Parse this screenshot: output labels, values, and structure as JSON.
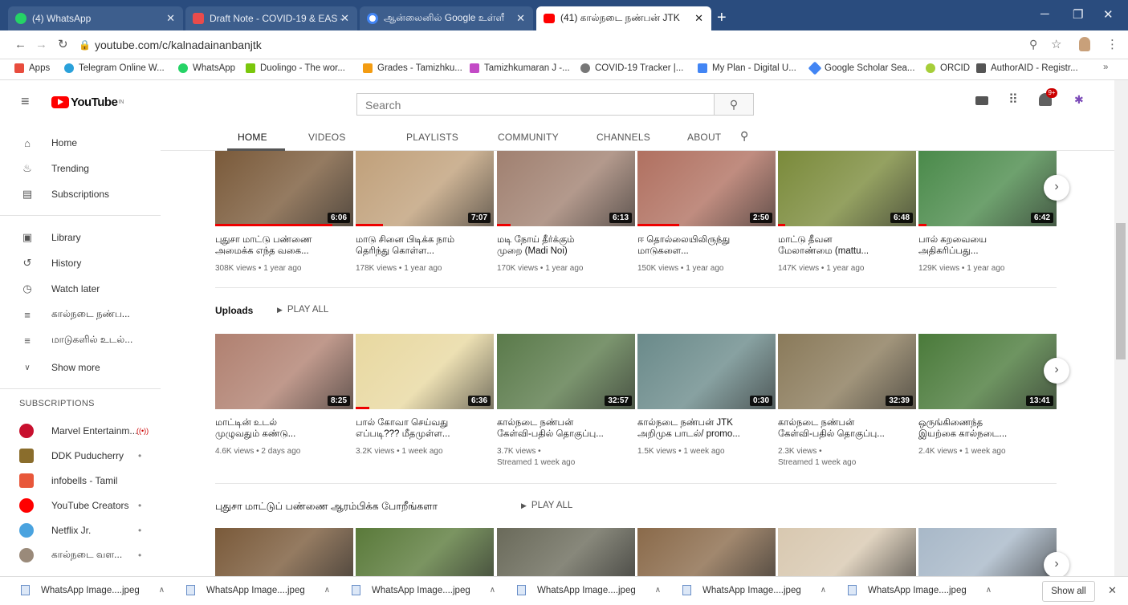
{
  "browser": {
    "tabs": [
      {
        "label": "(4) WhatsApp",
        "color": "#25d366"
      },
      {
        "label": "Draft Note - COVID-19 & EAS -",
        "color": "#e94b4b"
      },
      {
        "label": "ஆன்லைனில் Google உள்ளீ",
        "color": "#ffffff"
      },
      {
        "label": "(41) கால்நடை நண்பன் JTK",
        "color": "#ff0000"
      }
    ],
    "url": "youtube.com/c/kalnadainanbanjtk",
    "bookmarks": [
      {
        "label": "Apps",
        "color": "#e84c3d"
      },
      {
        "label": "Telegram Online W...",
        "color": "#2aa1da"
      },
      {
        "label": "WhatsApp",
        "color": "#25d366"
      },
      {
        "label": "Duolingo - The wor...",
        "color": "#7ac70c"
      },
      {
        "label": "Grades - Tamizhku...",
        "color": "#f39c12"
      },
      {
        "label": "Tamizhkumaran J -...",
        "color": "#c34ac6"
      },
      {
        "label": "COVID-19 Tracker |...",
        "color": "#777777"
      },
      {
        "label": "My Plan - Digital U...",
        "color": "#4285f4"
      },
      {
        "label": "Google Scholar Sea...",
        "color": "#4285f4"
      },
      {
        "label": "ORCID",
        "color": "#a6ce39"
      },
      {
        "label": "AuthorAID - Registr...",
        "color": "#555555"
      }
    ]
  },
  "youtube": {
    "logo": "YouTube",
    "logo_sup": "IN",
    "search_placeholder": "Search",
    "notif_count": "9+"
  },
  "sidebar": {
    "main": [
      {
        "label": "Home",
        "icon": "home-icon"
      },
      {
        "label": "Trending",
        "icon": "flame-icon"
      },
      {
        "label": "Subscriptions",
        "icon": "subscriptions-icon"
      }
    ],
    "library": [
      {
        "label": "Library",
        "icon": "library-icon"
      },
      {
        "label": "History",
        "icon": "history-icon"
      },
      {
        "label": "Watch later",
        "icon": "clock-icon"
      },
      {
        "label": "கால்நடை நண்ப...",
        "icon": "playlist-icon"
      },
      {
        "label": "மாடுகளில் உடல்...",
        "icon": "playlist-icon"
      },
      {
        "label": "Show more",
        "icon": "chevron-down-icon"
      }
    ],
    "subscriptions_header": "SUBSCRIPTIONS",
    "subscriptions": [
      {
        "label": "Marvel Entertainm...",
        "badge": "((•))",
        "color": "#c8102e"
      },
      {
        "label": "DDK Puducherry",
        "badge": "•",
        "color": "#8a6d2c"
      },
      {
        "label": "infobells - Tamil",
        "badge": "",
        "color": "#e8573a"
      },
      {
        "label": "YouTube Creators",
        "badge": "•",
        "color": "#ff0000"
      },
      {
        "label": "Netflix Jr.",
        "badge": "•",
        "color": "#4aa3df"
      },
      {
        "label": "கால்நடை வள...",
        "badge": "•",
        "color": "#9a8a7a"
      }
    ]
  },
  "channel_tabs": [
    "HOME",
    "VIDEOS",
    "PLAYLISTS",
    "COMMUNITY",
    "CHANNELS",
    "ABOUT"
  ],
  "shelves": {
    "top": {
      "videos": [
        {
          "title1": "புதுசா மாட்டு பண்ணை",
          "title2": "அமைக்க எந்த வகை...",
          "meta1": "308K views • 1 year ago",
          "meta2": "",
          "duration": "6:06",
          "color": "#7a5a3a",
          "progress": 0.85
        },
        {
          "title1": "மாடு சினை பிடிக்க நாம்",
          "title2": "தெரிந்து கொள்ள...",
          "meta1": "178K views • 1 year ago",
          "meta2": "",
          "duration": "7:07",
          "color": "#c0a07a",
          "progress": 0.2
        },
        {
          "title1": "மடி நோய் தீர்க்கும்",
          "title2": "முறை (Madi Noi)",
          "meta1": "170K views • 1 year ago",
          "meta2": "",
          "duration": "6:13",
          "color": "#a08070",
          "progress": 0.1
        },
        {
          "title1": "ஈ தொல்லையிலிருந்து",
          "title2": "மாடுகளை...",
          "meta1": "150K views • 1 year ago",
          "meta2": "",
          "duration": "2:50",
          "color": "#b07060",
          "progress": 0.3
        },
        {
          "title1": "மாட்டு தீவன",
          "title2": "மேலாண்மை (mattu...",
          "meta1": "147K views • 1 year ago",
          "meta2": "",
          "duration": "6:48",
          "color": "#7a8a3a",
          "progress": 0.05
        },
        {
          "title1": "பால் கறவையை",
          "title2": "அதிகரிப்பது...",
          "meta1": "129K views • 1 year ago",
          "meta2": "",
          "duration": "6:42",
          "color": "#4a8a4a",
          "progress": 0.06
        }
      ]
    },
    "uploads": {
      "title": "Uploads",
      "play_all": "PLAY ALL",
      "videos": [
        {
          "title1": "மாட்டின் உடல்",
          "title2": "முழுவதும் கண்டு...",
          "meta1": "4.6K views • 2 days ago",
          "meta2": "",
          "duration": "8:25",
          "color": "#b08070",
          "progress": 0
        },
        {
          "title1": "பால் கோவா செய்வது",
          "title2": "எப்படி??? மீதமுள்ள...",
          "meta1": "3.2K views • 1 week ago",
          "meta2": "",
          "duration": "6:36",
          "color": "#e8d8a0",
          "progress": 0.1
        },
        {
          "title1": "கால்நடை நண்பன்",
          "title2": "கேள்வி-பதில் தொகுப்பு...",
          "meta1": "3.7K views •",
          "meta2": "Streamed 1 week ago",
          "duration": "32:57",
          "color": "#5a7a4a",
          "progress": 0
        },
        {
          "title1": "கால்நடை நண்பன் JTK",
          "title2": "அறிமுக பாடல்/ promo...",
          "meta1": "1.5K views • 1 week ago",
          "meta2": "",
          "duration": "0:30",
          "color": "#6a8a8a",
          "progress": 0
        },
        {
          "title1": "கால்நடை நண்பன்",
          "title2": "கேள்வி-பதில் தொகுப்பு...",
          "meta1": "2.3K views •",
          "meta2": "Streamed 1 week ago",
          "duration": "32:39",
          "color": "#8a7a5a",
          "progress": 0
        },
        {
          "title1": "ஒருங்கிணைந்த",
          "title2": "இயற்கை கால்நடை...",
          "meta1": "2.4K views • 1 week ago",
          "meta2": "",
          "duration": "13:41",
          "color": "#4a7a3a",
          "progress": 0
        }
      ]
    },
    "third": {
      "title": "புதுசா மாட்டுப் பண்ணை ஆரம்பிக்க போறீங்களா",
      "play_all": "PLAY ALL",
      "videos": [
        {
          "color": "#7a5a3a"
        },
        {
          "color": "#5a7a3a"
        },
        {
          "color": "#6a6a5a"
        },
        {
          "color": "#8a6a4a"
        },
        {
          "color": "#d8c8b0"
        },
        {
          "color": "#a8b8c8"
        }
      ]
    }
  },
  "downloads": {
    "items": [
      "WhatsApp Image....jpeg",
      "WhatsApp Image....jpeg",
      "WhatsApp Image....jpeg",
      "WhatsApp Image....jpeg",
      "WhatsApp Image....jpeg",
      "WhatsApp Image....jpeg"
    ],
    "show_all": "Show all"
  }
}
